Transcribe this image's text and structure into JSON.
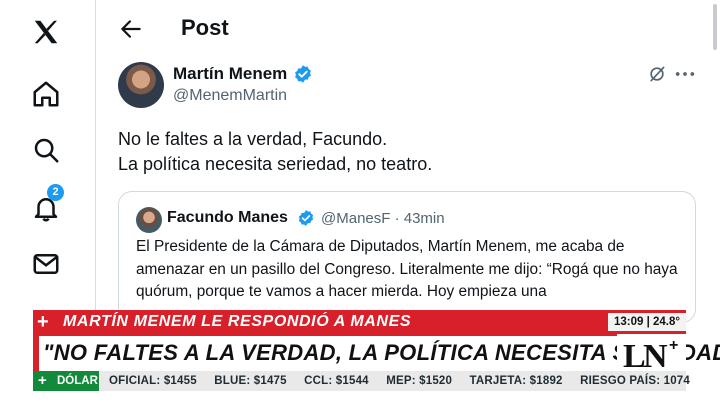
{
  "nav": {
    "icons": [
      "x-logo-icon",
      "home-icon",
      "search-icon",
      "notifications-icon",
      "messages-icon"
    ],
    "notification_count": "2"
  },
  "header": {
    "title": "Post"
  },
  "post": {
    "author_name": "Martín Menem",
    "author_handle": "@MenemMartin",
    "lines": [
      "No le faltes a la verdad, Facundo.",
      "La política necesita seriedad, no teatro."
    ]
  },
  "quote": {
    "author_name": "Facundo Manes",
    "author_handle": "@ManesF · 43min",
    "text": "El Presidente de la Cámara de Diputados, Martín Menem, me acaba de amenazar en un pasillo del Congreso. Literalmente me dijo: “Rogá que no haya quórum, porque te vamos a hacer mierda. Hoy empieza una"
  },
  "tv": {
    "top_plus": "+",
    "top_headline": "MARTÍN MENEM LE RESPONDIÓ A MANES",
    "clock": "13:09 | 24.8°",
    "main_headline": "\"NO FALTES A LA VERDAD, LA POLÍTICA NECESITA SERIEDAD\"",
    "logo": "LN+",
    "ticker_plus": "+",
    "ticker_label": "DÓLAR",
    "ticker_items": [
      "OFICIAL: $1455",
      "BLUE: $1475",
      "CCL: $1544",
      "MEP: $1520",
      "TARJETA: $1892",
      "RIESGO PAÍS: 1074"
    ]
  },
  "colors": {
    "accent": "#1d9bf0",
    "tv_red": "#d8202b",
    "tv_green": "#128a3a"
  }
}
